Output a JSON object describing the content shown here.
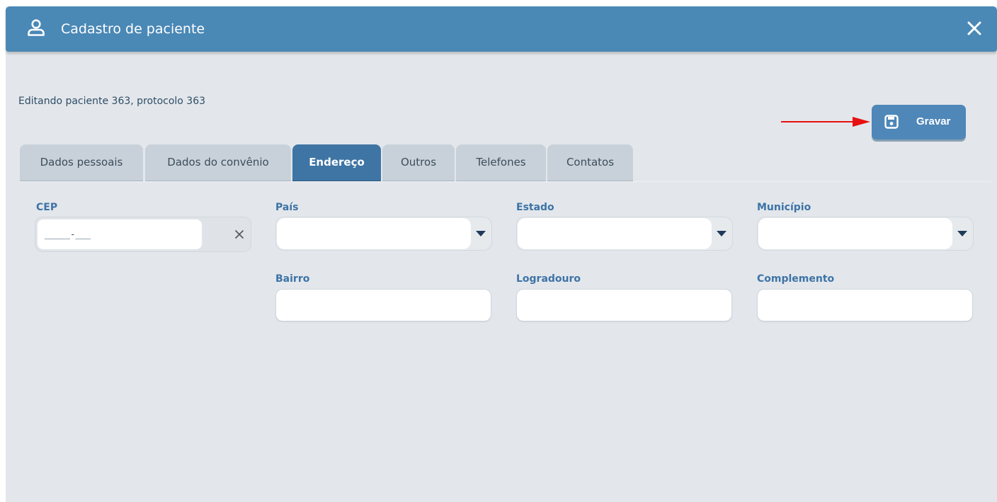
{
  "window": {
    "title": "Cadastro de paciente",
    "subtitle": "Editando paciente 363, protocolo 363"
  },
  "toolbar": {
    "save_label": "Gravar"
  },
  "tabs": [
    {
      "label": "Dados pessoais",
      "active": false
    },
    {
      "label": "Dados do convênio",
      "active": false
    },
    {
      "label": "Endereço",
      "active": true
    },
    {
      "label": "Outros",
      "active": false
    },
    {
      "label": "Telefones",
      "active": false
    },
    {
      "label": "Contatos",
      "active": false
    }
  ],
  "form": {
    "cep": {
      "label": "CEP",
      "value": "_____-___"
    },
    "pais": {
      "label": "País",
      "value": ""
    },
    "estado": {
      "label": "Estado",
      "value": ""
    },
    "municipio": {
      "label": "Município",
      "value": ""
    },
    "bairro": {
      "label": "Bairro",
      "value": ""
    },
    "logradouro": {
      "label": "Logradouro",
      "value": ""
    },
    "complemento": {
      "label": "Complemento",
      "value": ""
    }
  },
  "colors": {
    "header": "#4a88b6",
    "accent": "#3e75a4",
    "label": "#3e73a6",
    "background": "#e3e7eb",
    "annotation_arrow": "#e81010"
  },
  "icons": {
    "title": "user-icon",
    "close": "close-icon",
    "save": "floppy-disk-icon",
    "clear": "clear-x-icon",
    "dropdown": "caret-down-icon"
  }
}
